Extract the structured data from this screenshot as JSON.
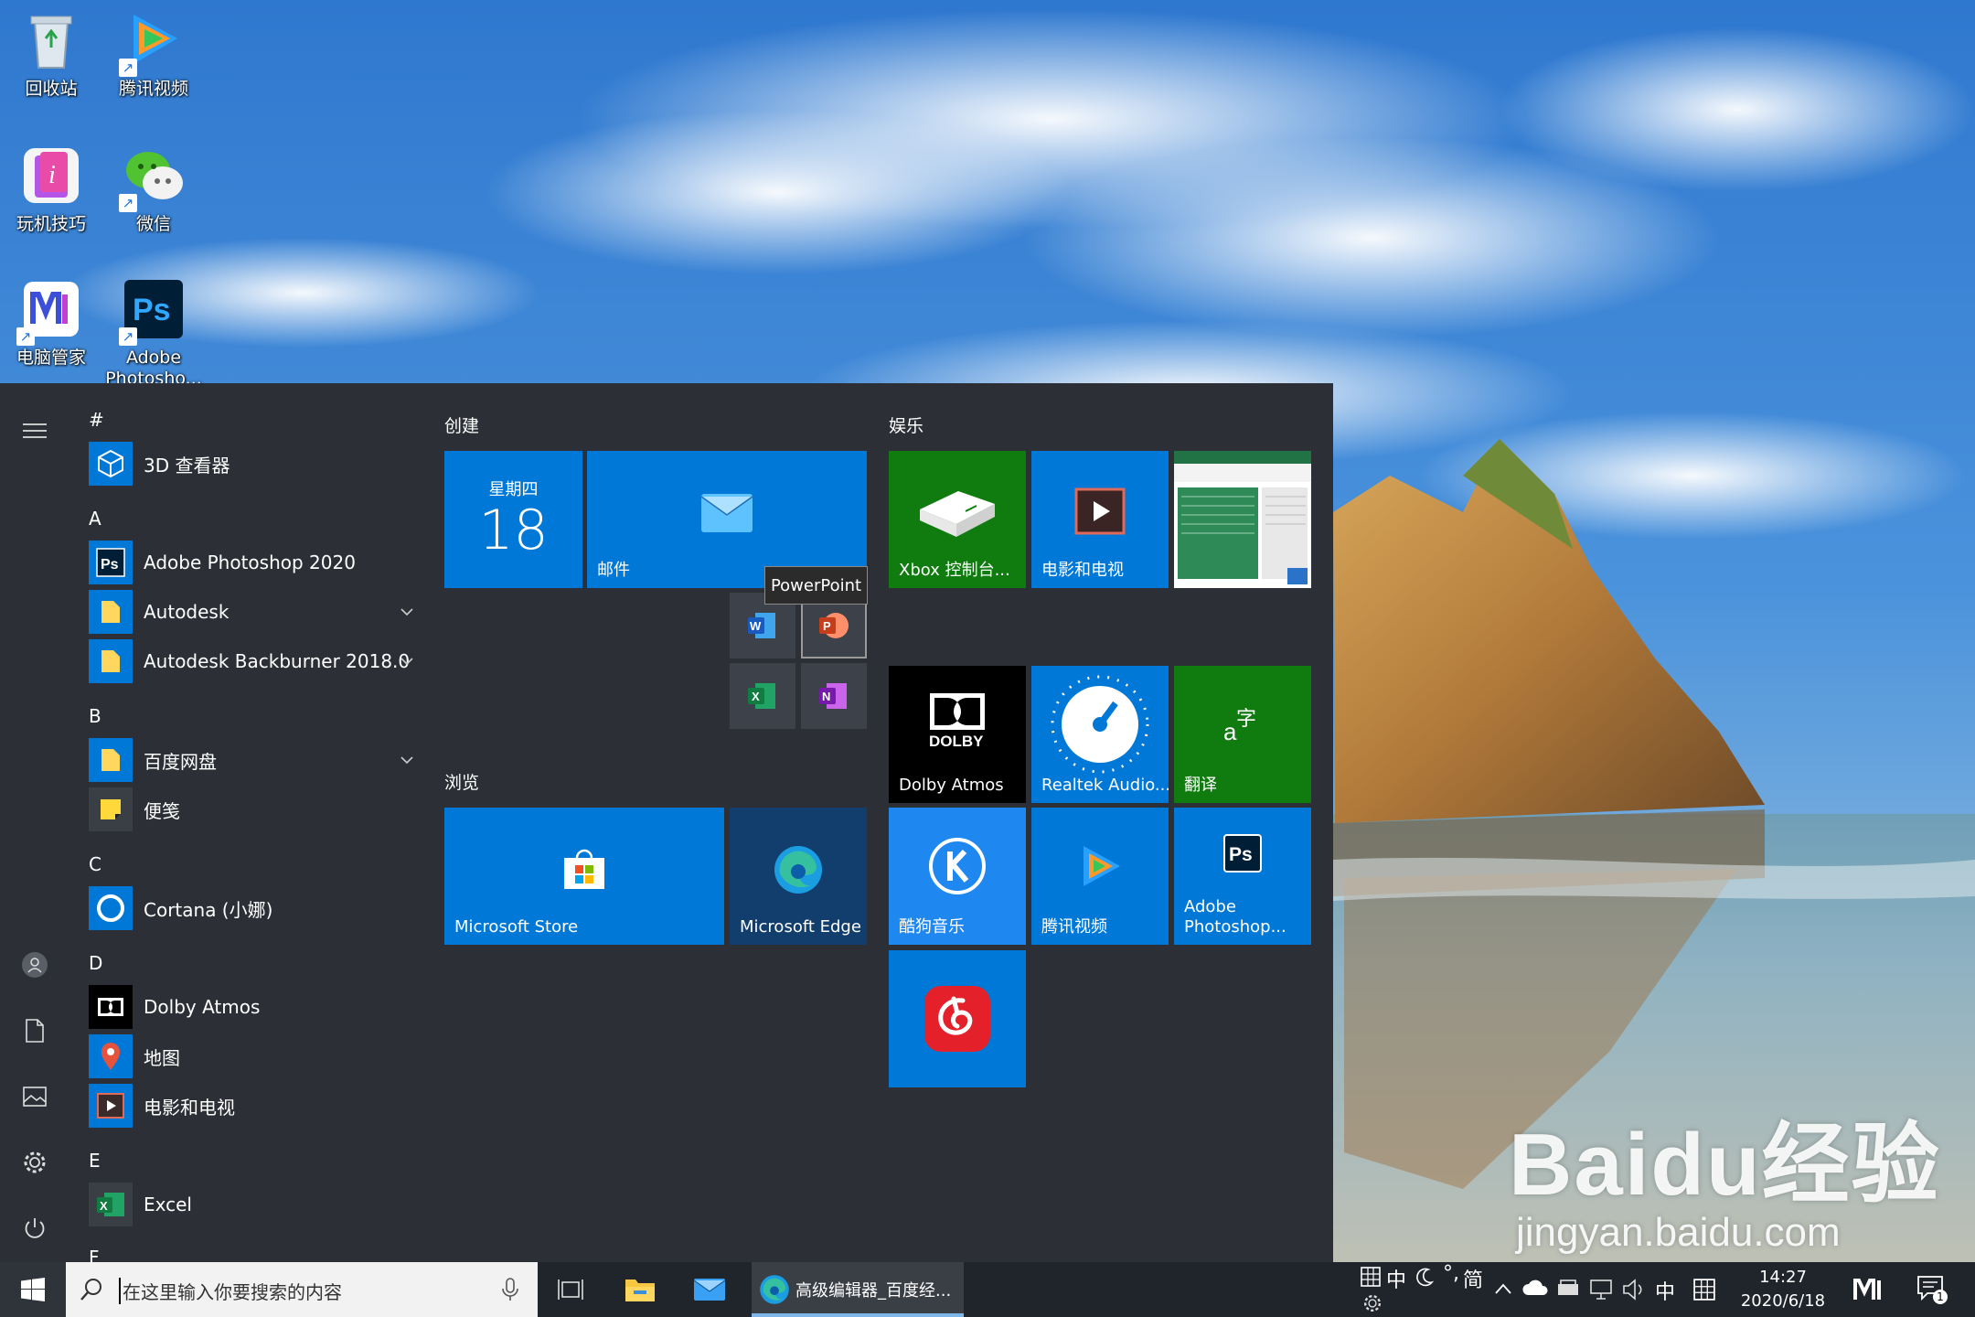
{
  "desktop": {
    "icons": [
      {
        "label": "回收站"
      },
      {
        "label": "腾讯视频"
      },
      {
        "label": "玩机技巧"
      },
      {
        "label": "微信"
      },
      {
        "label": "电脑管家"
      },
      {
        "label": "Adobe Photosho..."
      }
    ]
  },
  "watermark": {
    "brand": "Baidu",
    "brand_cn": "经验",
    "url": "jingyan.baidu.com"
  },
  "start_menu": {
    "rail_icons": [
      "hamburger-icon",
      "user-icon",
      "document-icon",
      "pictures-icon",
      "settings-icon",
      "power-icon"
    ],
    "app_list": {
      "letters": [
        "#",
        "A",
        "B",
        "C",
        "D",
        "E",
        "F"
      ],
      "apps": [
        {
          "name": "3D 查看器",
          "icon": "cube-icon"
        },
        {
          "name": "Adobe Photoshop 2020",
          "icon": "photoshop-icon"
        },
        {
          "name": "Autodesk",
          "icon": "folder-icon",
          "expandable": true
        },
        {
          "name": "Autodesk Backburner 2018.0",
          "icon": "folder-icon",
          "expandable": true
        },
        {
          "name": "百度网盘",
          "icon": "folder-icon",
          "expandable": true
        },
        {
          "name": "便笺",
          "icon": "sticky-notes-icon"
        },
        {
          "name": "Cortana (小娜)",
          "icon": "cortana-icon"
        },
        {
          "name": "Dolby Atmos",
          "icon": "dolby-icon"
        },
        {
          "name": "地图",
          "icon": "maps-icon"
        },
        {
          "name": "电影和电视",
          "icon": "movies-icon"
        },
        {
          "name": "Excel",
          "icon": "excel-icon"
        }
      ]
    },
    "groups": {
      "create": {
        "title": "创建",
        "calendar_day": "星期四",
        "calendar_date": "18",
        "mail_label": "邮件",
        "office_tooltip": "PowerPoint"
      },
      "browse": {
        "title": "浏览",
        "store_label": "Microsoft Store",
        "edge_label": "Microsoft Edge"
      },
      "entertainment": {
        "title": "娱乐",
        "tiles": [
          {
            "label": "Xbox 控制台...",
            "color": "#107c10"
          },
          {
            "label": "电影和电视",
            "color": "#0078d7"
          },
          {
            "label": "",
            "color": "#ffffff"
          },
          {
            "label": "Dolby Atmos",
            "color": "#000000"
          },
          {
            "label": "Realtek Audio...",
            "color": "#0078d7"
          },
          {
            "label": "翻译",
            "color": "#107c10"
          },
          {
            "label": "酷狗音乐",
            "color": "#1e87f0"
          },
          {
            "label": "腾讯视频",
            "color": "#0078d7"
          },
          {
            "label": "Adobe Photoshop...",
            "color": "#0078d7"
          },
          {
            "label": "",
            "color": "#0078d7"
          }
        ]
      }
    }
  },
  "taskbar": {
    "search_placeholder": "在这里输入你要搜索的内容",
    "active_window_title": "高级编辑器_百度经...",
    "ime": {
      "mode_cn": "中",
      "simplified": "简",
      "lang": "中"
    },
    "time": "14:27",
    "date": "2020/6/18",
    "notification_count": "1"
  },
  "colors": {
    "start_bg": "#2c3036",
    "tile_blue": "#0078d7",
    "taskbar_bg": "#20252c",
    "accent_underline": "#7eb6ea"
  }
}
